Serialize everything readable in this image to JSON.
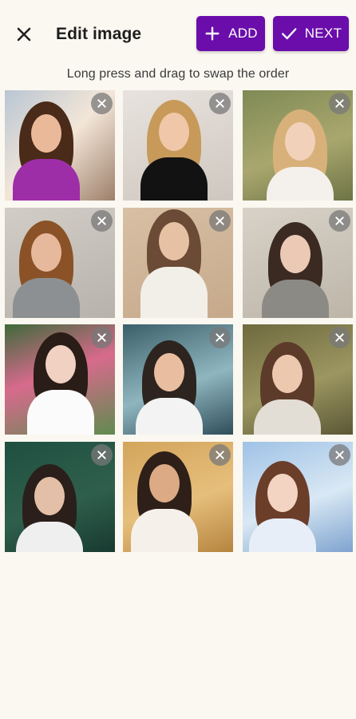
{
  "header": {
    "close_icon": "close-icon",
    "title": "Edit image",
    "add_label": "ADD",
    "add_icon": "plus-icon",
    "next_label": "NEXT",
    "next_icon": "check-icon",
    "accent_color": "#6a0dab"
  },
  "hint": "Long press and drag to swap the order",
  "photos": [
    {
      "id": 1,
      "remove_icon": "close-icon"
    },
    {
      "id": 2,
      "remove_icon": "close-icon"
    },
    {
      "id": 3,
      "remove_icon": "close-icon"
    },
    {
      "id": 4,
      "remove_icon": "close-icon"
    },
    {
      "id": 5,
      "remove_icon": "close-icon"
    },
    {
      "id": 6,
      "remove_icon": "close-icon"
    },
    {
      "id": 7,
      "remove_icon": "close-icon"
    },
    {
      "id": 8,
      "remove_icon": "close-icon"
    },
    {
      "id": 9,
      "remove_icon": "close-icon"
    },
    {
      "id": 10,
      "remove_icon": "close-icon"
    },
    {
      "id": 11,
      "remove_icon": "close-icon"
    },
    {
      "id": 12,
      "remove_icon": "close-icon"
    }
  ]
}
